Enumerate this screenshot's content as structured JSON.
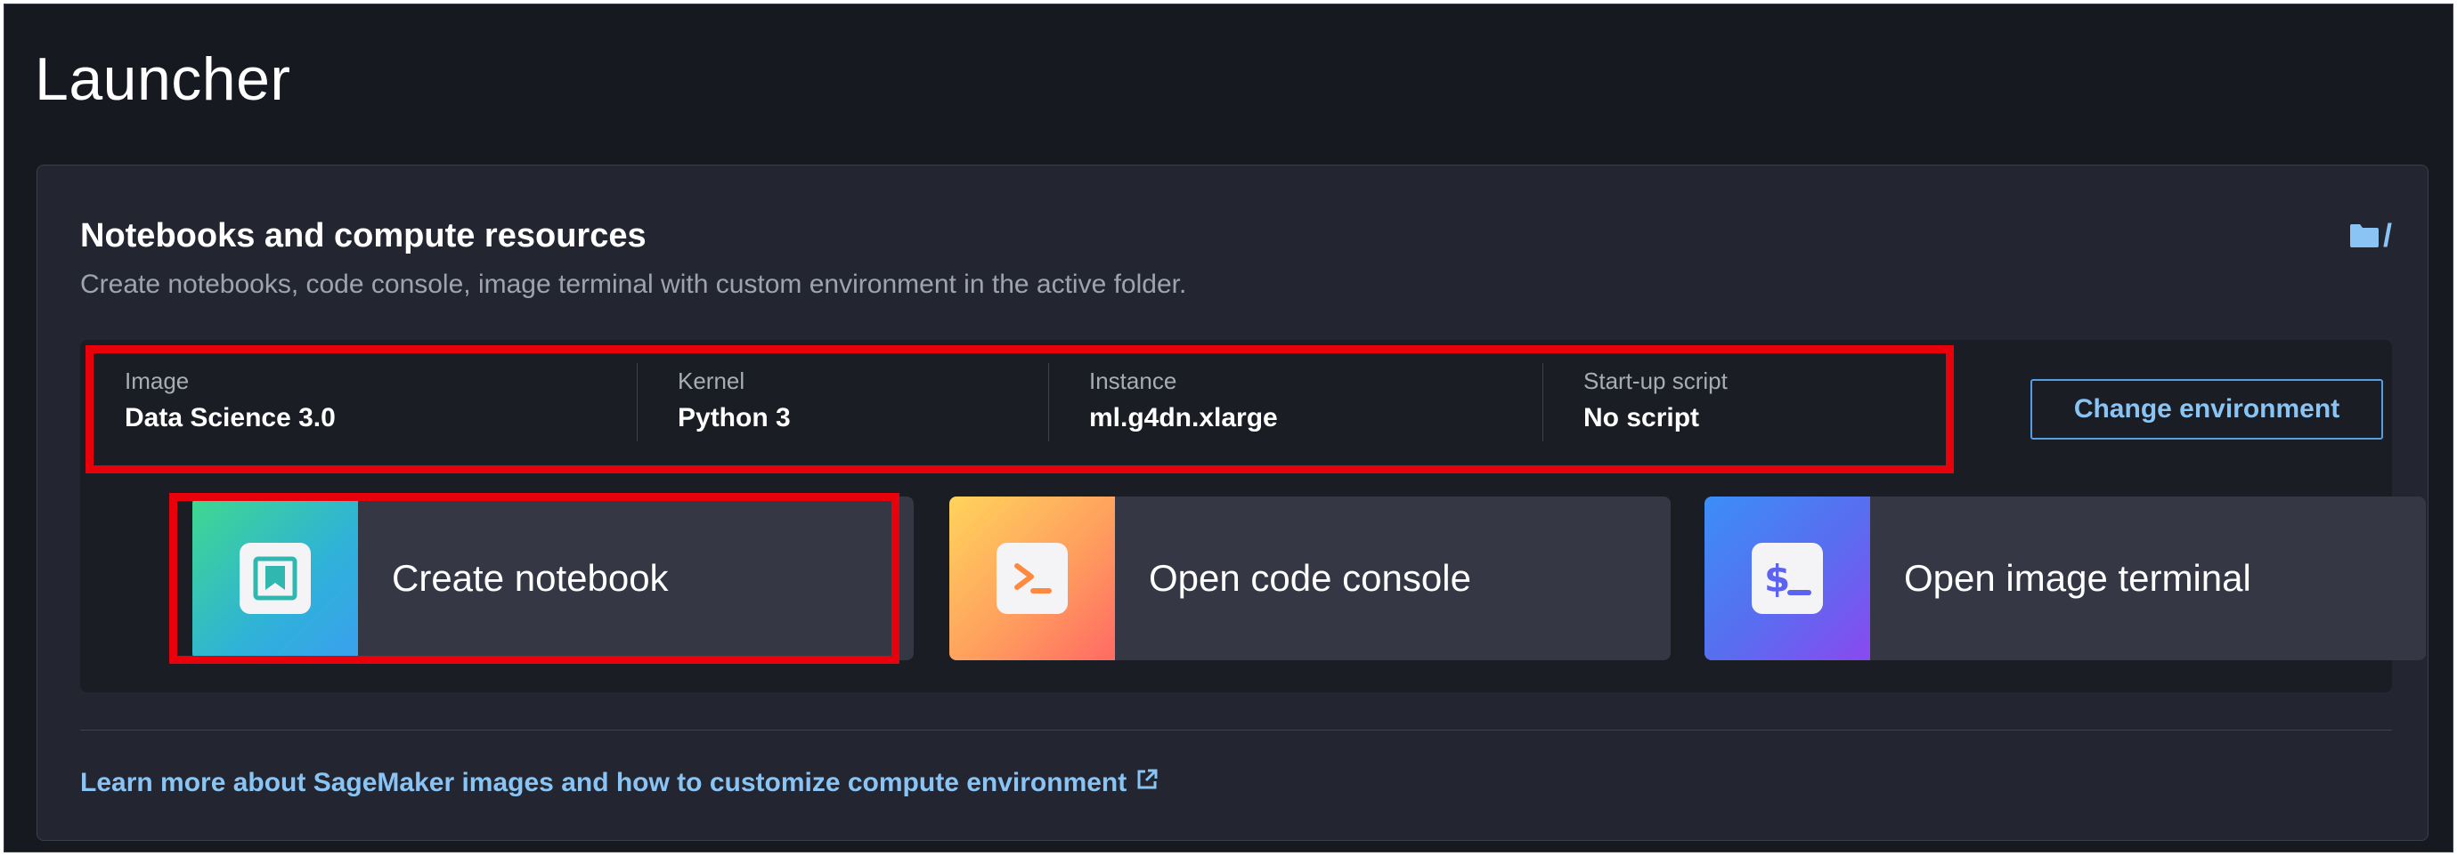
{
  "page": {
    "title": "Launcher"
  },
  "panel": {
    "title": "Notebooks and compute resources",
    "subtitle": "Create notebooks, code console, image terminal with custom environment in the active folder.",
    "folder_path": "/",
    "folder_icon": "folder-icon"
  },
  "environment": {
    "fields": [
      {
        "label": "Image",
        "value": "Data Science 3.0"
      },
      {
        "label": "Kernel",
        "value": "Python 3"
      },
      {
        "label": "Instance",
        "value": "ml.g4dn.xlarge"
      },
      {
        "label": "Start-up script",
        "value": "No script"
      }
    ],
    "change_button_label": "Change environment"
  },
  "tiles": [
    {
      "label": "Create notebook",
      "icon": "notebook-icon"
    },
    {
      "label": "Open code console",
      "icon": "terminal-prompt-icon"
    },
    {
      "label": "Open image terminal",
      "icon": "dollar-terminal-icon"
    }
  ],
  "learn_more": {
    "label": "Learn more about SageMaker images and how to customize compute environment",
    "icon": "external-link-icon"
  },
  "colors": {
    "background": "#16191f",
    "panel": "#232630",
    "accent_link": "#89c4f4",
    "highlight": "#e8000b"
  }
}
